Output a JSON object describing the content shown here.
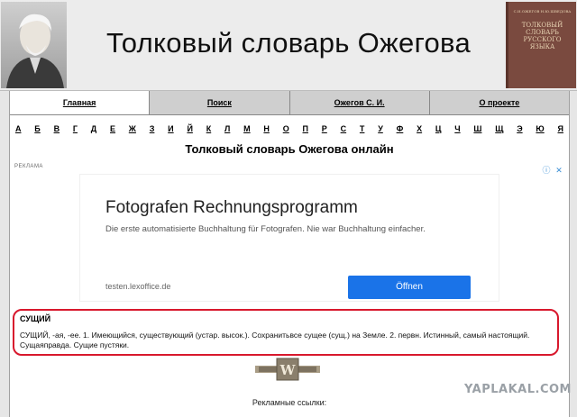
{
  "header": {
    "title": "Толковый словарь Ожегова",
    "book_small": "С.И.ОЖЕГОВ Н.Ю.ШВЕДОВА",
    "book_title": "ТОЛКОВЫЙ СЛОВАРЬ РУССКОГО ЯЗЫКА"
  },
  "tabs": [
    {
      "label": "Главная"
    },
    {
      "label": "Поиск"
    },
    {
      "label": "Ожегов С. И."
    },
    {
      "label": "О проекте"
    }
  ],
  "alphabet": [
    "А",
    "Б",
    "В",
    "Г",
    "Д",
    "Е",
    "Ж",
    "З",
    "И",
    "Й",
    "К",
    "Л",
    "М",
    "Н",
    "О",
    "П",
    "Р",
    "С",
    "Т",
    "У",
    "Ф",
    "Х",
    "Ц",
    "Ч",
    "Ш",
    "Щ",
    "Э",
    "Ю",
    "Я"
  ],
  "page_heading": "Толковый словарь Ожегова онлайн",
  "ad": {
    "label": "РЕКЛАМА",
    "title": "Fotografen Rechnungsprogramm",
    "description": "Die erste automatisierte Buchhaltung für Fotografen. Nie war Buchhaltung einfacher.",
    "url": "testen.lexoffice.de",
    "button": "Öffnen",
    "icons": [
      "info-icon",
      "close-icon"
    ]
  },
  "entry": {
    "word": "СУЩИЙ",
    "definition": "СУЩИЙ, -ая, -ее. 1. Имеющийся, существующий (устар. высок.). Сохранитьвсе сущее (сущ.) на Земле. 2. первн. Истинный, самый настоящий. Сущаяправда. Сущие пустяки."
  },
  "ads_links": "Рекламные ссылки:",
  "watermark": "YAPLAKAL.COM",
  "colors": {
    "highlight": "#d8182d",
    "ad_button": "#1a73e8",
    "book": "#7a4a3f"
  }
}
